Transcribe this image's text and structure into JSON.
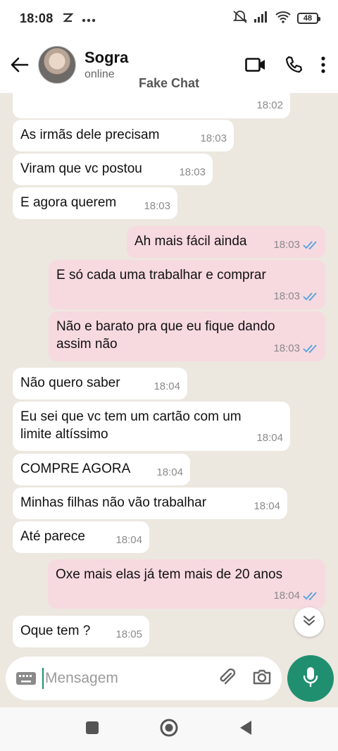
{
  "status_bar": {
    "time": "18:08",
    "battery": "48"
  },
  "header": {
    "contact_name": "Sogra",
    "contact_status": "online",
    "overlay_label": "Fake Chat"
  },
  "messages": [
    {
      "dir": "in",
      "text": "",
      "time": "18:02"
    },
    {
      "dir": "in",
      "text": "As irmãs dele precisam",
      "time": "18:03"
    },
    {
      "dir": "in",
      "text": "Viram que vc postou",
      "time": "18:03"
    },
    {
      "dir": "in",
      "text": "E agora querem",
      "time": "18:03"
    },
    {
      "dir": "out",
      "text": "Ah mais fácil ainda",
      "time": "18:03"
    },
    {
      "dir": "out",
      "text": "E só cada uma trabalhar e comprar",
      "time": "18:03"
    },
    {
      "dir": "out",
      "text": "Não e barato pra que eu fique dando assim não",
      "time": "18:03"
    },
    {
      "dir": "in",
      "text": "Não quero saber",
      "time": "18:04"
    },
    {
      "dir": "in",
      "text": "Eu sei que vc tem um cartão com um limite altíssimo",
      "time": "18:04"
    },
    {
      "dir": "in",
      "text": "COMPRE AGORA",
      "time": "18:04"
    },
    {
      "dir": "in",
      "text": "Minhas filhas não vão trabalhar",
      "time": "18:04"
    },
    {
      "dir": "in",
      "text": "Até parece",
      "time": "18:04"
    },
    {
      "dir": "out",
      "text": "Oxe mais elas já tem mais de 20 anos",
      "time": "18:04"
    },
    {
      "dir": "in",
      "text": "Oque tem ?",
      "time": "18:05"
    }
  ],
  "composer": {
    "placeholder": "Mensagem"
  },
  "colors": {
    "accent": "#1f8f6f",
    "outgoing_bubble": "#f7d9e0",
    "incoming_bubble": "#ffffff",
    "read_ticks": "#4fa3e0"
  }
}
